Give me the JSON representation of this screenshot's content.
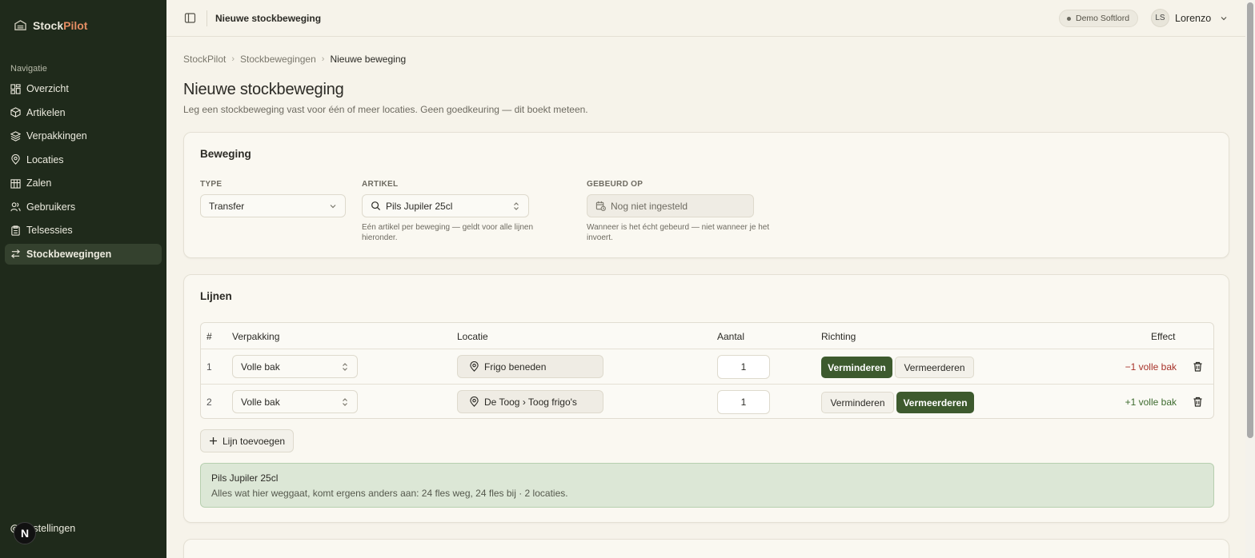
{
  "app": {
    "name_part1": "Stock",
    "name_part2": "Pilot",
    "accent_color": "#e48d63"
  },
  "sidebar": {
    "heading": "Navigatie",
    "items": [
      {
        "label": "Overzicht",
        "icon": "dashboard-icon"
      },
      {
        "label": "Artikelen",
        "icon": "box-icon"
      },
      {
        "label": "Verpakkingen",
        "icon": "layers-icon"
      },
      {
        "label": "Locaties",
        "icon": "map-pin-icon"
      },
      {
        "label": "Zalen",
        "icon": "building-icon"
      },
      {
        "label": "Gebruikers",
        "icon": "users-icon"
      },
      {
        "label": "Telsessies",
        "icon": "clipboard-icon"
      },
      {
        "label": "Stockbewegingen",
        "icon": "arrows-icon",
        "active": true
      }
    ],
    "settings_label": "Instellingen",
    "dev_badge": "N"
  },
  "topbar": {
    "title": "Nieuwe stockbeweging",
    "badge": "Demo Softlord",
    "user_initials": "LS",
    "user_name": "Lorenzo"
  },
  "breadcrumb": [
    "StockPilot",
    "Stockbewegingen",
    "Nieuwe beweging"
  ],
  "page": {
    "title": "Nieuwe stockbeweging",
    "subtitle": "Leg een stockbeweging vast voor één of meer locaties. Geen goedkeuring — dit boekt meteen."
  },
  "beweging": {
    "title": "Beweging",
    "type_label": "TYPE",
    "type_value": "Transfer",
    "artikel_label": "ARTIKEL",
    "artikel_value": "Pils Jupiler 25cl",
    "artikel_help": "Eén artikel per beweging — geldt voor alle lijnen hieronder.",
    "gebeurd_label": "GEBEURD OP",
    "gebeurd_placeholder": "Nog niet ingesteld",
    "gebeurd_help": "Wanneer is het écht gebeurd — niet wanneer je het invoert."
  },
  "lijnen": {
    "title": "Lijnen",
    "columns": [
      "#",
      "Verpakking",
      "Locatie",
      "Aantal",
      "Richting",
      "Effect"
    ],
    "rows": [
      {
        "num": "1",
        "verpakking": "Volle bak",
        "locatie": "Frigo beneden",
        "aantal": "1",
        "btn_minus": "Verminderen",
        "btn_plus": "Vermeerderen",
        "active": "minus",
        "effect": "−1 volle bak",
        "effect_color": "#a8332a"
      },
      {
        "num": "2",
        "verpakking": "Volle bak",
        "locatie": "De Toog › Toog frigo's",
        "aantal": "1",
        "btn_minus": "Verminderen",
        "btn_plus": "Vermeerderen",
        "active": "plus",
        "effect": "+1 volle bak",
        "effect_color": "#3d6b2e"
      }
    ],
    "add_label": "Lijn toevoegen",
    "summary_title": "Pils Jupiler 25cl",
    "summary_text": "Alles wat hier weggaat, komt ergens anders aan: 24 fles weg, 24 fles bij · 2 locaties."
  },
  "colors": {
    "sidebar_bg": "#1f2a1b",
    "primary_green": "#3d5a2e",
    "summary_bg": "#dce7d6"
  }
}
